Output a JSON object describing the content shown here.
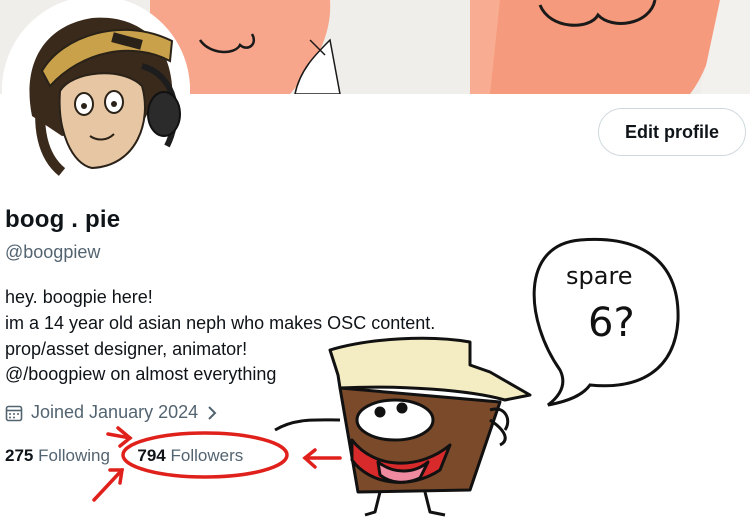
{
  "profile": {
    "display_name": "boog . pie",
    "handle": "@boogpiew",
    "bio": [
      "hey. boogpie here!",
      "im a 14 year old asian neph who makes OSC content.",
      "prop/asset designer, animator!",
      "@/boogpiew on almost everything"
    ],
    "joined": "Joined January 2024",
    "following_count": "275",
    "following_label": "Following",
    "followers_count": "794",
    "followers_label": "Followers"
  },
  "actions": {
    "edit_profile_label": "Edit profile"
  },
  "icons": {
    "calendar": "calendar-icon",
    "chevron": "chevron-right-icon"
  },
  "annotation": {
    "speech_text_line1": "spare",
    "speech_text_line2": "6?"
  },
  "colors": {
    "annotation_red": "#e0201b",
    "banner_skin": "#f6a58a",
    "muted_text": "#536471"
  }
}
